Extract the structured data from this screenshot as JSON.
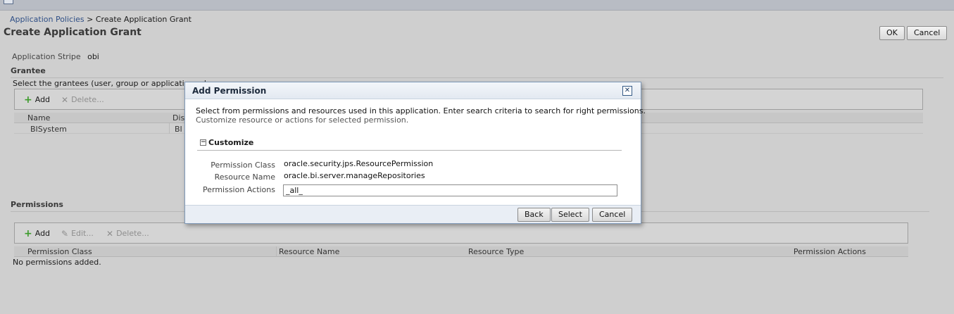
{
  "breadcrumb": {
    "parent": "Application Policies",
    "separator": ">",
    "current": "Create Application Grant"
  },
  "page": {
    "title": "Create Application Grant",
    "ok_label": "OK",
    "cancel_label": "Cancel"
  },
  "stripe": {
    "label": "Application Stripe",
    "value": "obi"
  },
  "grantee": {
    "heading": "Grantee",
    "description": "Select the grantees (user, group or application role",
    "add_label": "Add",
    "delete_label": "Delete...",
    "columns": [
      "Name",
      "Disp"
    ],
    "rows": [
      {
        "name": "BISystem",
        "display": "BI"
      }
    ]
  },
  "permissions": {
    "heading": "Permissions",
    "add_label": "Add",
    "edit_label": "Edit...",
    "delete_label": "Delete...",
    "columns": [
      "Permission Class",
      "Resource Name",
      "Resource Type",
      "Permission Actions"
    ],
    "empty_text": "No permissions added."
  },
  "dialog": {
    "title": "Add Permission",
    "close_icon": "close-icon",
    "line1": "Select from permissions and resources used in this application. Enter search criteria to search for right permissions.",
    "line2": "Customize resource or actions for selected permission.",
    "section": "Customize",
    "fields": {
      "class_label": "Permission Class",
      "class_value": "oracle.security.jps.ResourcePermission",
      "resource_label": "Resource Name",
      "resource_value": "oracle.bi.server.manageRepositories",
      "actions_label": "Permission Actions",
      "actions_value": "_all_"
    },
    "back_label": "Back",
    "select_label": "Select",
    "cancel_label": "Cancel"
  },
  "colors": {
    "overlay": "#cfcfcf",
    "link": "#2f4f86",
    "dialog_border": "#7f99b8",
    "add_icon": "#3c9b2b"
  }
}
